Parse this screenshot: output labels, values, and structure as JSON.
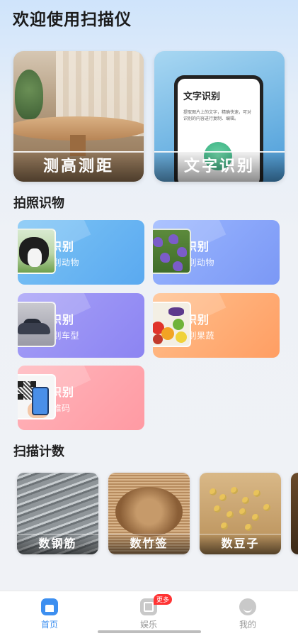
{
  "app_title": "欢迎使用扫描仪",
  "hero": {
    "measure_label": "测高测距",
    "ocr_label": "文字识别",
    "ocr_phone_title": "文字识别",
    "ocr_phone_desc": "提取图片上的文字，精确快速，可对识别的内容进行复制、编辑。"
  },
  "photo_section_title": "拍照识物",
  "features": [
    {
      "title": "动物识别",
      "subtitle": "拍照识别动物"
    },
    {
      "title": "植物识别",
      "subtitle": "快速识别动物"
    },
    {
      "title": "车型识别",
      "subtitle": "智能识别车型"
    },
    {
      "title": "果蔬识别",
      "subtitle": "轻松识别果蔬"
    },
    {
      "title": "扫码识别",
      "subtitle": "识别二维码"
    }
  ],
  "count_section_title": "扫描计数",
  "counts": [
    {
      "label": "数钢筋"
    },
    {
      "label": "数竹签"
    },
    {
      "label": "数豆子"
    }
  ],
  "nav": {
    "home": "首页",
    "fun": "娱乐",
    "fun_badge": "更多",
    "me": "我的"
  },
  "colors": {
    "accent": "#3d8ff0",
    "badge": "#ff3333"
  }
}
